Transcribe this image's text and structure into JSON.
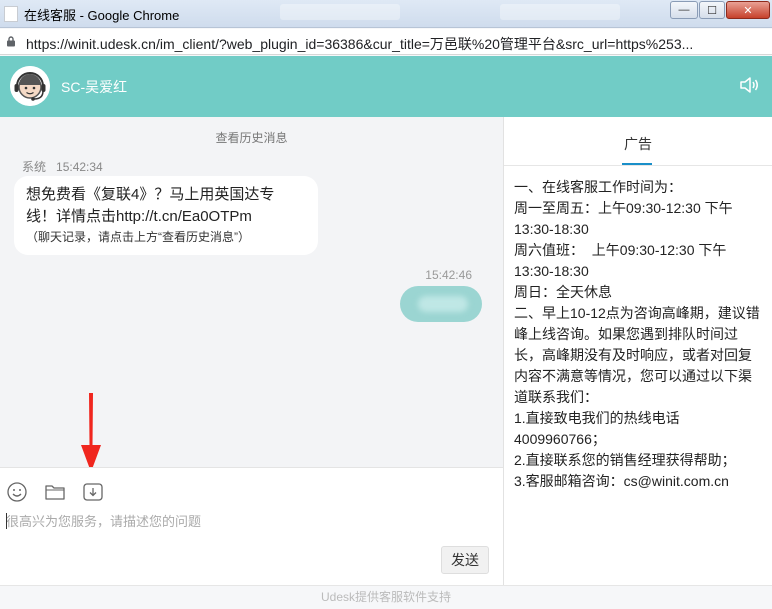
{
  "window": {
    "title": "在线客服 - Google Chrome",
    "minimize_glyph": "—",
    "maximize_glyph": "☐",
    "close_glyph": "✕"
  },
  "address_bar": {
    "url": "https://winit.udesk.cn/im_client/?web_plugin_id=36386&cur_title=万邑联%20管理平台&src_url=https%253..."
  },
  "header": {
    "agent_name": "SC-吴爱红",
    "accent_color": "#71ccc6"
  },
  "chat": {
    "history_link": "查看历史消息",
    "messages": [
      {
        "sender": "系统",
        "time": "15:42:34",
        "lines": [
          "想免费看《复联4》？马上用英国达专",
          "线！详情点击http://t.cn/Ea0OTPm"
        ],
        "note": "（聊天记录，请点击上方“查看历史消息”）"
      },
      {
        "time": "15:42:46"
      }
    ]
  },
  "toolbar": {
    "emoji": "emoji-icon",
    "file": "folder-icon",
    "download": "download-icon"
  },
  "input": {
    "placeholder": "很高兴为您服务，请描述您的问题",
    "value": ""
  },
  "send_label": "发送",
  "sidebar": {
    "tab_label": "广告",
    "lines": [
      "一、在线客服工作时间为：",
      "周一至周五：上午09:30-12:30 下午",
      "13:30-18:30",
      "周六值班：  上午09:30-12:30 下午",
      "13:30-18:30",
      "周日：全天休息",
      "二、早上10-12点为咨询高峰期，建议错",
      "峰上线咨询。如果您遇到排队时间过",
      "长，高峰期没有及时响应，或者对回复",
      "内容不满意等情况，您可以通过以下渠",
      "道联系我们：",
      "1.直接致电我们的热线电话",
      "4009960766；",
      "2.直接联系您的销售经理获得帮助；",
      "3.客服邮箱咨询：cs@winit.com.cn"
    ]
  },
  "footer": "Udesk提供客服软件支持"
}
